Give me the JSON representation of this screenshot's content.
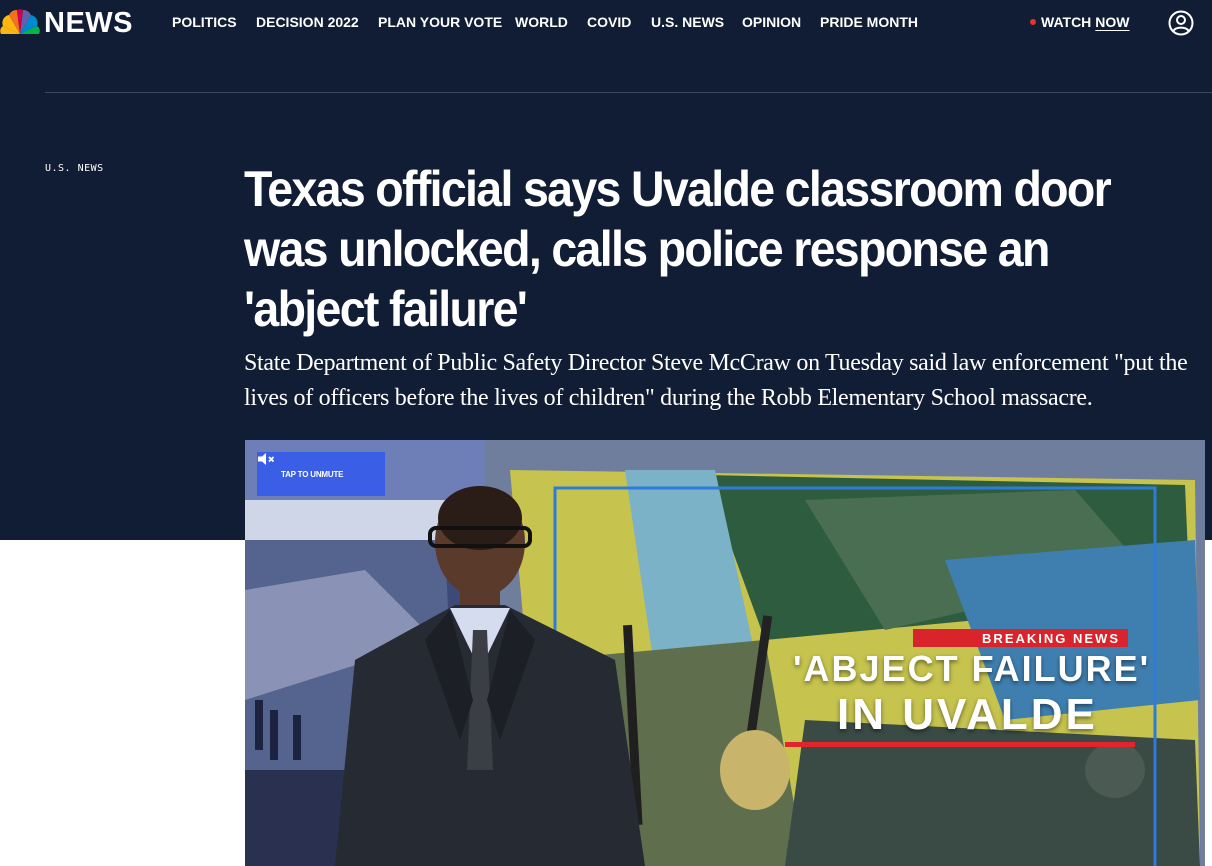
{
  "brand": {
    "logo_text": "NEWS",
    "peacock_colors": [
      "#fcb711",
      "#f37021",
      "#cc004c",
      "#6460aa",
      "#0089d0",
      "#0db14b"
    ]
  },
  "nav": {
    "items": [
      {
        "label": "POLITICS"
      },
      {
        "label": "DECISION 2022"
      },
      {
        "label": "PLAN YOUR VOTE"
      },
      {
        "label": "WORLD"
      },
      {
        "label": "COVID"
      },
      {
        "label": "U.S. NEWS"
      },
      {
        "label": "OPINION"
      },
      {
        "label": "PRIDE MONTH"
      }
    ],
    "watch_label": "WATCH",
    "watch_now_label": "NOW",
    "account_icon": "user-circle-icon"
  },
  "article": {
    "section": "U.S. NEWS",
    "headline": "Texas official says Uvalde classroom door was unlocked, calls police response an 'abject failure'",
    "dek": "State Department of Public Safety Director Steve McCraw on Tuesday said law enforcement \"put the lives of officers before the lives of children\" during the Robb Elementary School massacre."
  },
  "video": {
    "unmute_label": "TAP TO UNMUTE",
    "mute_icon": "speaker-muted-icon",
    "graphic": {
      "breaking": "BREAKING NEWS",
      "line1": "'ABJECT FAILURE'",
      "line2": "IN UVALDE"
    }
  },
  "colors": {
    "header_bg": "#111d34",
    "unmute_bg": "#3a5fe6",
    "breaking_red": "#d9242b",
    "live_dot": "#e8312f"
  }
}
